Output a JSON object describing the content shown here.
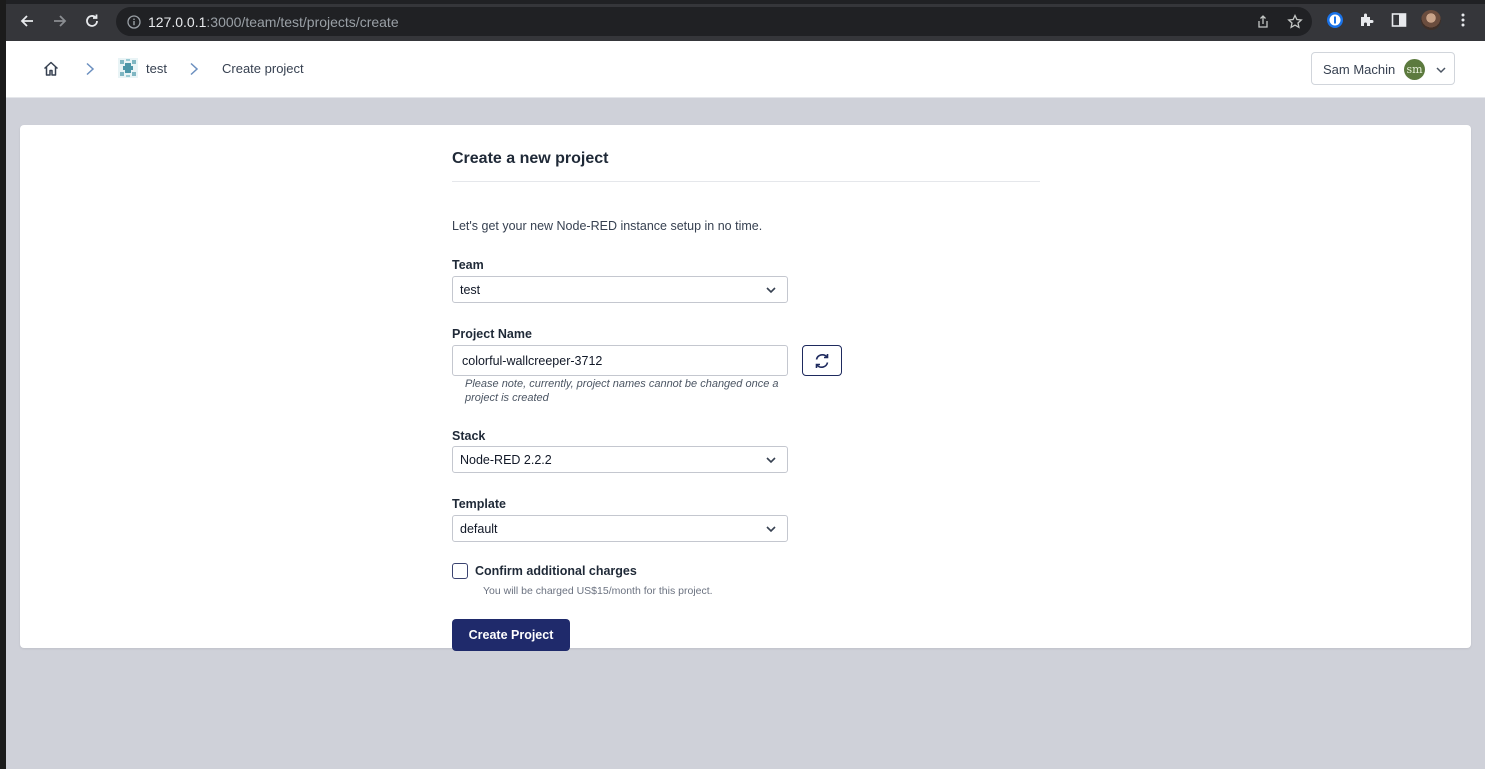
{
  "browser": {
    "url_host": "127.0.0.1",
    "url_rest": ":3000/team/test/projects/create"
  },
  "breadcrumb": {
    "team": "test",
    "current": "Create project"
  },
  "user": {
    "name": "Sam Machin",
    "initials": "sm"
  },
  "form": {
    "title": "Create a new project",
    "intro": "Let's get your new Node-RED instance setup in no time.",
    "team_label": "Team",
    "team_value": "test",
    "project_name_label": "Project Name",
    "project_name_value": "colorful-wallcreeper-3712",
    "project_name_hint": "Please note, currently, project names cannot be changed once a project is created",
    "stack_label": "Stack",
    "stack_value": "Node-RED 2.2.2",
    "template_label": "Template",
    "template_value": "default",
    "confirm_label": "Confirm additional charges",
    "confirm_sub": "You will be charged US$15/month for this project.",
    "submit_label": "Create Project"
  },
  "colors": {
    "primary": "#1f2a6b",
    "page_bg": "#cfd1d9",
    "avatar": "#5c7a3e"
  }
}
